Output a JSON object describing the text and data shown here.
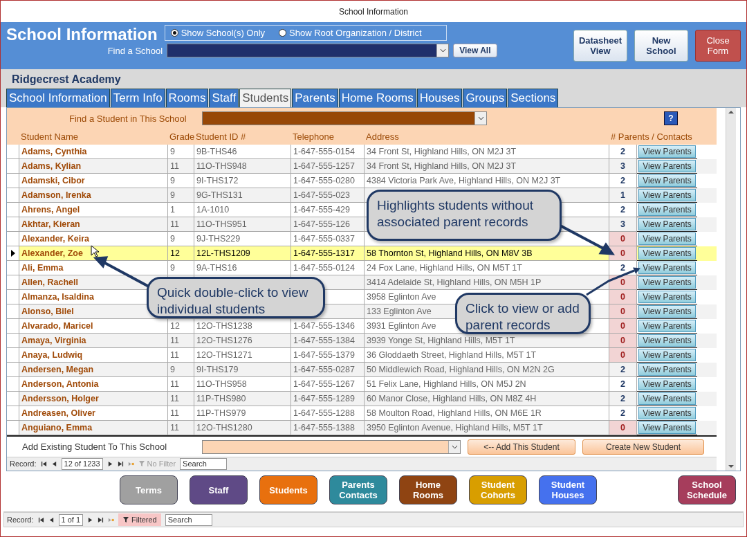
{
  "window": {
    "title": "School Information"
  },
  "header": {
    "title": "School Information",
    "radios": [
      {
        "label": "Show School(s) Only",
        "selected": true
      },
      {
        "label": "Show Root Organization / District",
        "selected": false
      }
    ],
    "find_label": "Find a School",
    "view_all": "View All",
    "buttons": [
      {
        "label": "Datasheet View",
        "kind": "normal"
      },
      {
        "label": "New School",
        "kind": "normal"
      },
      {
        "label": "Close Form",
        "kind": "danger"
      }
    ]
  },
  "school_name": "Ridgecrest Academy",
  "tabs": [
    {
      "label": "School Information",
      "selected": false
    },
    {
      "label": "Term Info",
      "selected": false
    },
    {
      "label": "Rooms",
      "selected": false
    },
    {
      "label": "Staff",
      "selected": false
    },
    {
      "label": "Students",
      "selected": true
    },
    {
      "label": "Parents",
      "selected": false
    },
    {
      "label": "Home Rooms",
      "selected": false
    },
    {
      "label": "Houses",
      "selected": false
    },
    {
      "label": "Groups",
      "selected": false
    },
    {
      "label": "Sections",
      "selected": false
    }
  ],
  "subform": {
    "find_label": "Find a Student in This School",
    "help": "?",
    "columns": [
      "Student Name",
      "Grade",
      "Student ID #",
      "Telephone",
      "Address",
      "# Parents / Contacts"
    ],
    "rows": [
      {
        "name": "Adams, Cynthia",
        "grade": "9",
        "student_id": "9B-THS46",
        "telephone": "1-647-555-0154",
        "address": "34 Front St, Highland Hills, ON M2J 3T",
        "parents": "2",
        "no_parents": false,
        "selected": false,
        "button": "View Parents"
      },
      {
        "name": "Adams, Kylian",
        "grade": "11",
        "student_id": "11O-THS948",
        "telephone": "1-647-555-1257",
        "address": "34 Front St, Highland Hills, ON M2J 3T",
        "parents": "3",
        "no_parents": false,
        "selected": false,
        "button": "View Parents"
      },
      {
        "name": "Adamski, Cibor",
        "grade": "9",
        "student_id": "9I-THS172",
        "telephone": "1-647-555-0280",
        "address": "4384 Victoria Park Ave, Highland Hills, ON M2J 3T",
        "parents": "2",
        "no_parents": false,
        "selected": false,
        "button": "View Parents"
      },
      {
        "name": "Adamson, Irenka",
        "grade": "9",
        "student_id": "9G-THS131",
        "telephone": "1-647-555-023",
        "parents": "1",
        "no_parents": false,
        "selected": false,
        "button": "View Parents"
      },
      {
        "name": "Ahrens, Angel",
        "grade": "1",
        "student_id": "1A-1010",
        "telephone": "1-647-555-429",
        "parents": "2",
        "no_parents": false,
        "selected": false,
        "button": "View Parents"
      },
      {
        "name": "Akhtar, Kieran",
        "grade": "11",
        "student_id": "11O-THS951",
        "telephone": "1-647-555-126",
        "parents": "3",
        "no_parents": false,
        "selected": false,
        "button": "View Parents"
      },
      {
        "name": "Alexander, Keira",
        "grade": "9",
        "student_id": "9J-THS229",
        "telephone": "1-647-555-0337",
        "parents": "0",
        "no_parents": true,
        "selected": false,
        "button": "View Parents"
      },
      {
        "name": "Alexander, Zoe",
        "grade": "12",
        "student_id": "12L-THS1209",
        "telephone": "1-647-555-1317",
        "address": "58 Thornton St, Highland Hills, ON M8V 3B",
        "parents": "0",
        "no_parents": true,
        "selected": true,
        "button": "View Parents"
      },
      {
        "name": "Ali, Emma",
        "grade": "9",
        "student_id": "9A-THS16",
        "telephone": "1-647-555-0124",
        "address": "24 Fox Lane, Highland Hills, ON M5T 1T",
        "parents": "2",
        "no_parents": false,
        "selected": false,
        "button": "View Parents"
      },
      {
        "name": "Allen, Rachell",
        "address": "3414 Adelaide St, Highland Hills, ON M5H 1P",
        "parents": "0",
        "no_parents": true,
        "selected": false,
        "button": "View Parents"
      },
      {
        "name": "Almanza, Isaldina",
        "address": "3958 Eglinton Ave",
        "parents": "0",
        "no_parents": true,
        "selected": false,
        "button": "View Parents"
      },
      {
        "name": "Alonso, Bilel",
        "address": "133 Eglinton Ave",
        "parents": "0",
        "no_parents": true,
        "selected": false,
        "button": "View Parents"
      },
      {
        "name": "Alvarado, Maricel",
        "grade": "12",
        "student_id": "12O-THS1238",
        "telephone": "1-647-555-1346",
        "address": "3931 Eglinton Ave",
        "parents": "0",
        "no_parents": true,
        "selected": false,
        "button": "View Parents"
      },
      {
        "name": "Amaya, Virginia",
        "grade": "11",
        "student_id": "12O-THS1276",
        "telephone": "1-647-555-1384",
        "address": "3939 Yonge St, Highland Hills,  M5T 1T",
        "parents": "0",
        "no_parents": true,
        "selected": false,
        "button": "View Parents"
      },
      {
        "name": "Anaya, Ludwiq",
        "grade": "11",
        "student_id": "12O-THS1271",
        "telephone": "1-647-555-1379",
        "address": "36 Gloddaeth Street, Highland Hills,  M5T 1T",
        "parents": "0",
        "no_parents": true,
        "selected": false,
        "button": "View Parents"
      },
      {
        "name": "Andersen, Megan",
        "grade": "9",
        "student_id": "9I-THS179",
        "telephone": "1-647-555-0287",
        "address": "50 Middlewich Road, Highland Hills, ON M2N 2G",
        "parents": "2",
        "no_parents": false,
        "selected": false,
        "button": "View Parents"
      },
      {
        "name": "Anderson, Antonia",
        "grade": "11",
        "student_id": "11O-THS958",
        "telephone": "1-647-555-1267",
        "address": "51 Felix Lane, Highland Hills, ON M5J 2N",
        "parents": "2",
        "no_parents": false,
        "selected": false,
        "button": "View Parents"
      },
      {
        "name": "Andersson, Holger",
        "grade": "11",
        "student_id": "11P-THS980",
        "telephone": "1-647-555-1289",
        "address": "60 Manor Close, Highland Hills, ON M8Z 4H",
        "parents": "2",
        "no_parents": false,
        "selected": false,
        "button": "View Parents"
      },
      {
        "name": "Andreasen, Oliver",
        "grade": "11",
        "student_id": "11P-THS979",
        "telephone": "1-647-555-1288",
        "address": "58 Moulton Road, Highland Hills, ON M6E 1R",
        "parents": "2",
        "no_parents": false,
        "selected": false,
        "button": "View Parents"
      },
      {
        "name": "Anguiano, Emma",
        "grade": "11",
        "student_id": "12O-THS1280",
        "telephone": "1-647-555-1388",
        "address": "3950 Eglinton Avenue, Highland Hills,  M5T 1T",
        "parents": "0",
        "no_parents": true,
        "selected": false,
        "button": "View Parents"
      }
    ],
    "add_label": "Add Existing Student To This School",
    "add_button": "<-- Add This Student",
    "create_button": "Create New Student",
    "nav": {
      "label": "Record:",
      "position": "12 of 1233",
      "filter": "No Filter",
      "filter_disabled": true,
      "search": "Search"
    }
  },
  "callouts": [
    {
      "text": "Highlights students without associated parent records"
    },
    {
      "text": "Quick double-click to view individual students"
    },
    {
      "text": "Click to view or add parent records"
    }
  ],
  "nav_buttons": [
    {
      "label": "Terms",
      "color": "#a0a0a0"
    },
    {
      "label": "Staff",
      "color": "#5f4a86"
    },
    {
      "label": "Students",
      "color": "#e8700e"
    },
    {
      "label": "Parents Contacts",
      "color": "#2e8a9c"
    },
    {
      "label": "Home Rooms",
      "color": "#8f4412"
    },
    {
      "label": "Student Cohorts",
      "color": "#d89e00"
    },
    {
      "label": "Student Houses",
      "color": "#4571ee"
    },
    {
      "label": "School Schedule",
      "color": "#a63d5c"
    }
  ],
  "record_nav": {
    "label": "Record:",
    "position": "1 of 1",
    "filter": "Filtered",
    "filter_disabled": false,
    "search": "Search"
  }
}
